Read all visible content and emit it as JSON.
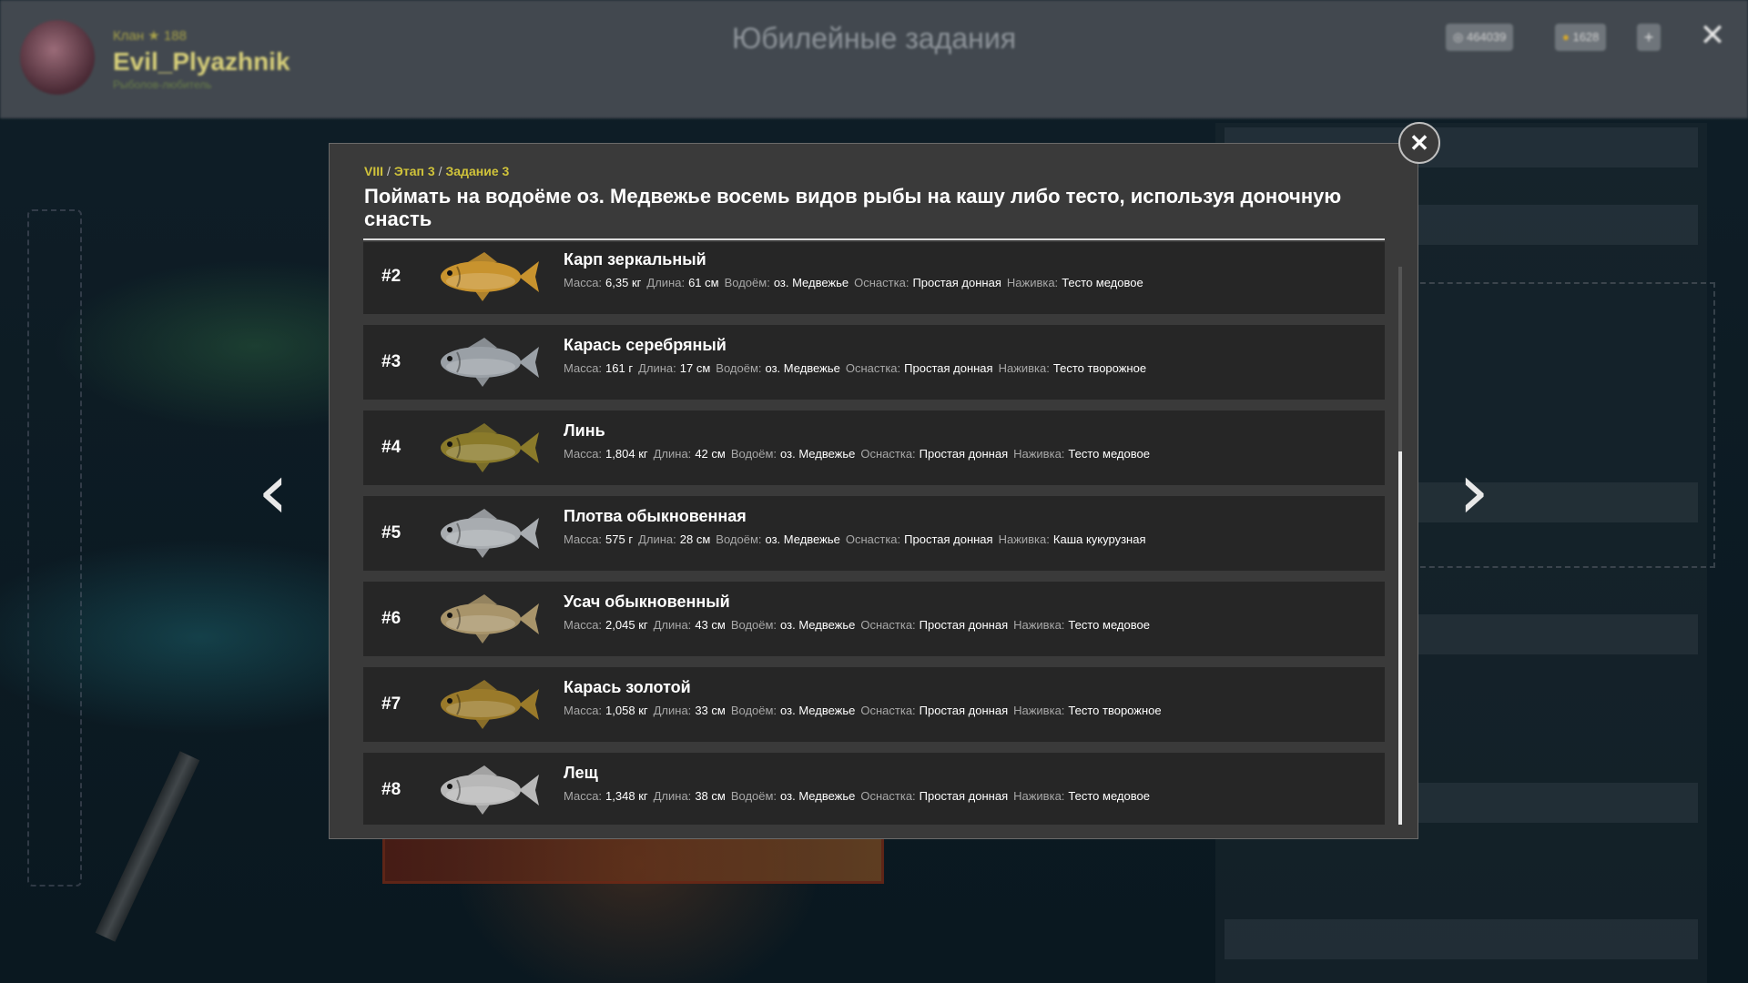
{
  "header": {
    "rank": "Клан ★ 188",
    "player_name": "Evil_Plyazhnik",
    "player_sub": "Рыболов-любитель",
    "title": "Юбилейные задания",
    "currency_silver": "464039",
    "currency_gold": "1628",
    "plus_label": "+",
    "close_glyph": "✕"
  },
  "nav": {
    "prev_glyph": "‹",
    "next_glyph": "›"
  },
  "modal": {
    "close_glyph": "✕",
    "breadcrumb": {
      "chapter": "VIII",
      "stage": "Этап 3",
      "task": "Задание 3",
      "separator": "/"
    },
    "title": "Поймать на водоёме оз. Медвежье восемь видов рыбы на кашу либо тесто, используя доночную снасть",
    "labels": {
      "mass": "Масса:",
      "length": "Длина:",
      "water": "Водоём:",
      "tackle": "Оснастка:",
      "bait": "Наживка:"
    },
    "fish": [
      {
        "num": "#2",
        "name": "Карп зеркальный",
        "mass": "6,35 кг",
        "length": "61 см",
        "water": "оз. Медвежье",
        "tackle": "Простая донная",
        "bait": "Тесто медовое",
        "color": "#c8932e",
        "icon": "carp-fish-icon"
      },
      {
        "num": "#3",
        "name": "Карась серебряный",
        "mass": "161 г",
        "length": "17 см",
        "water": "оз. Медвежье",
        "tackle": "Простая донная",
        "bait": "Тесто творожное",
        "color": "#9aa0a6",
        "icon": "silver-crucian-fish-icon"
      },
      {
        "num": "#4",
        "name": "Линь",
        "mass": "1,804 кг",
        "length": "42 см",
        "water": "оз. Медвежье",
        "tackle": "Простая донная",
        "bait": "Тесто медовое",
        "color": "#8a7a2a",
        "icon": "tench-fish-icon"
      },
      {
        "num": "#5",
        "name": "Плотва обыкновенная",
        "mass": "575 г",
        "length": "28 см",
        "water": "оз. Медвежье",
        "tackle": "Простая донная",
        "bait": "Каша кукурузная",
        "color": "#a8acb0",
        "icon": "roach-fish-icon"
      },
      {
        "num": "#6",
        "name": "Усач обыкновенный",
        "mass": "2,045 кг",
        "length": "43 см",
        "water": "оз. Медвежье",
        "tackle": "Простая донная",
        "bait": "Тесто медовое",
        "color": "#a8946a",
        "icon": "barbel-fish-icon"
      },
      {
        "num": "#7",
        "name": "Карась золотой",
        "mass": "1,058 кг",
        "length": "33 см",
        "water": "оз. Медвежье",
        "tackle": "Простая донная",
        "bait": "Тесто творожное",
        "color": "#9a7a2a",
        "icon": "golden-crucian-fish-icon"
      },
      {
        "num": "#8",
        "name": "Лещ",
        "mass": "1,348 кг",
        "length": "38 см",
        "water": "оз. Медвежье",
        "tackle": "Простая донная",
        "bait": "Тесто медовое",
        "color": "#b8b8b8",
        "icon": "bream-fish-icon"
      }
    ]
  }
}
